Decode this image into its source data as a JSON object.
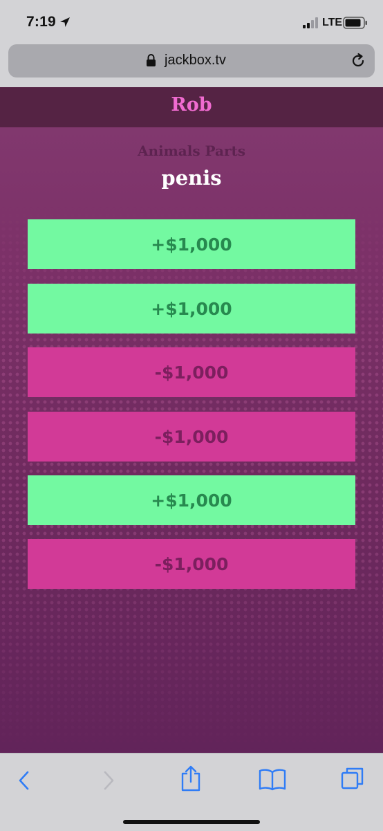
{
  "status_bar": {
    "time": "7:19",
    "network": "LTE",
    "icons": [
      "location-arrow-icon",
      "signal-icon",
      "battery-icon"
    ]
  },
  "browser": {
    "url": "jackbox.tv",
    "icons": [
      "lock-icon",
      "reload-icon"
    ]
  },
  "game": {
    "player_name": "Rob",
    "category": "Animals Parts",
    "answer": "penis",
    "bets": [
      {
        "label": "+$1,000",
        "kind": "plus"
      },
      {
        "label": "+$1,000",
        "kind": "plus"
      },
      {
        "label": "-$1,000",
        "kind": "minus"
      },
      {
        "label": "-$1,000",
        "kind": "minus"
      },
      {
        "label": "+$1,000",
        "kind": "plus"
      },
      {
        "label": "-$1,000",
        "kind": "minus"
      }
    ]
  },
  "toolbar": {
    "icons": [
      "back-icon",
      "forward-icon",
      "share-icon",
      "bookmarks-icon",
      "tabs-icon"
    ]
  },
  "colors": {
    "background": "#7c3168",
    "header": "#552344",
    "player_name": "#f06bd0",
    "plus_button": "#73f9a1",
    "plus_text": "#27894f",
    "minus_button": "#d23a97",
    "minus_text": "#7c1f5e",
    "ios_blue": "#2f7cf6"
  }
}
